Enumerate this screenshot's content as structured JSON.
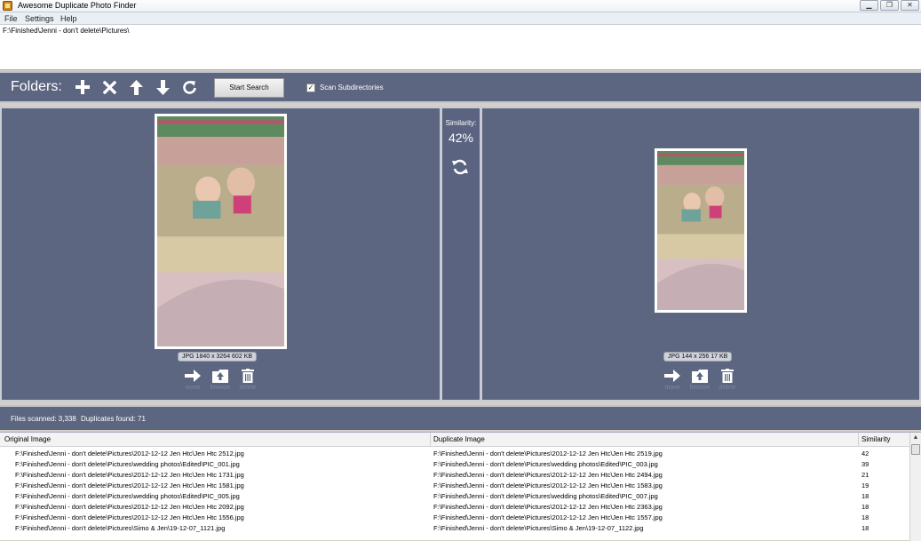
{
  "window": {
    "title": "Awesome Duplicate Photo Finder",
    "minimize": "▁",
    "maximize": "❐",
    "close": "✕"
  },
  "menu": {
    "file": "File",
    "settings": "Settings",
    "help": "Help"
  },
  "folders": {
    "paths": [
      "F:\\Finished\\Jenni - don't delete\\Pictures\\"
    ]
  },
  "toolbar": {
    "label": "Folders:",
    "start_search": "Start Search",
    "scan_subdirectories": "Scan Subdirectories",
    "scan_subdirectories_checked": true
  },
  "left_image": {
    "info": "JPG  1840 x 3264  602 KB",
    "actions": {
      "move": "move",
      "browse": "browse",
      "delete": "delete"
    }
  },
  "right_image": {
    "info": "JPG  144 x 256  17 KB",
    "actions": {
      "move": "move",
      "browse": "browse",
      "delete": "delete"
    }
  },
  "similarity": {
    "label": "Similarity:",
    "value": "42%"
  },
  "status": {
    "files_scanned": "Files scanned: 3,338",
    "duplicates_found": "Duplicates found: 71"
  },
  "results": {
    "columns": {
      "original": "Original Image",
      "duplicate": "Duplicate Image",
      "similarity": "Similarity"
    },
    "rows": [
      {
        "original": "F:\\Finished\\Jenni - don't delete\\Pictures\\2012-12-12 Jen Htc\\Jen Htc 2512.jpg",
        "duplicate": "F:\\Finished\\Jenni - don't delete\\Pictures\\2012-12-12 Jen Htc\\Jen Htc 2519.jpg",
        "similarity": "42"
      },
      {
        "original": "F:\\Finished\\Jenni - don't delete\\Pictures\\wedding photos\\Edited\\PIC_001.jpg",
        "duplicate": "F:\\Finished\\Jenni - don't delete\\Pictures\\wedding photos\\Edited\\PIC_003.jpg",
        "similarity": "39"
      },
      {
        "original": "F:\\Finished\\Jenni - don't delete\\Pictures\\2012-12-12 Jen Htc\\Jen Htc 1731.jpg",
        "duplicate": "F:\\Finished\\Jenni - don't delete\\Pictures\\2012-12-12 Jen Htc\\Jen Htc 2494.jpg",
        "similarity": "21"
      },
      {
        "original": "F:\\Finished\\Jenni - don't delete\\Pictures\\2012-12-12 Jen Htc\\Jen Htc 1581.jpg",
        "duplicate": "F:\\Finished\\Jenni - don't delete\\Pictures\\2012-12-12 Jen Htc\\Jen Htc 1583.jpg",
        "similarity": "19"
      },
      {
        "original": "F:\\Finished\\Jenni - don't delete\\Pictures\\wedding photos\\Edited\\PIC_005.jpg",
        "duplicate": "F:\\Finished\\Jenni - don't delete\\Pictures\\wedding photos\\Edited\\PIC_007.jpg",
        "similarity": "18"
      },
      {
        "original": "F:\\Finished\\Jenni - don't delete\\Pictures\\2012-12-12 Jen Htc\\Jen Htc 2092.jpg",
        "duplicate": "F:\\Finished\\Jenni - don't delete\\Pictures\\2012-12-12 Jen Htc\\Jen Htc 2363.jpg",
        "similarity": "18"
      },
      {
        "original": "F:\\Finished\\Jenni - don't delete\\Pictures\\2012-12-12 Jen Htc\\Jen Htc 1556.jpg",
        "duplicate": "F:\\Finished\\Jenni - don't delete\\Pictures\\2012-12-12 Jen Htc\\Jen Htc 1557.jpg",
        "similarity": "18"
      },
      {
        "original": "F:\\Finished\\Jenni - don't delete\\Pictures\\Simo & Jen\\19-12-07_1121.jpg",
        "duplicate": "F:\\Finished\\Jenni - don't delete\\Pictures\\Simo & Jen\\19-12-07_1122.jpg",
        "similarity": "18"
      }
    ]
  },
  "colors": {
    "panel": "#5d6680",
    "panel_border": "#c0c4cc",
    "action_label": "#7e869c"
  },
  "icons": {
    "toolbar": [
      "plus-icon",
      "x-icon",
      "arrow-up-icon",
      "arrow-down-icon",
      "refresh-icon"
    ],
    "actions": [
      "arrow-right-icon",
      "folder-upload-icon",
      "trash-icon"
    ],
    "similarity": "swap-icon"
  }
}
